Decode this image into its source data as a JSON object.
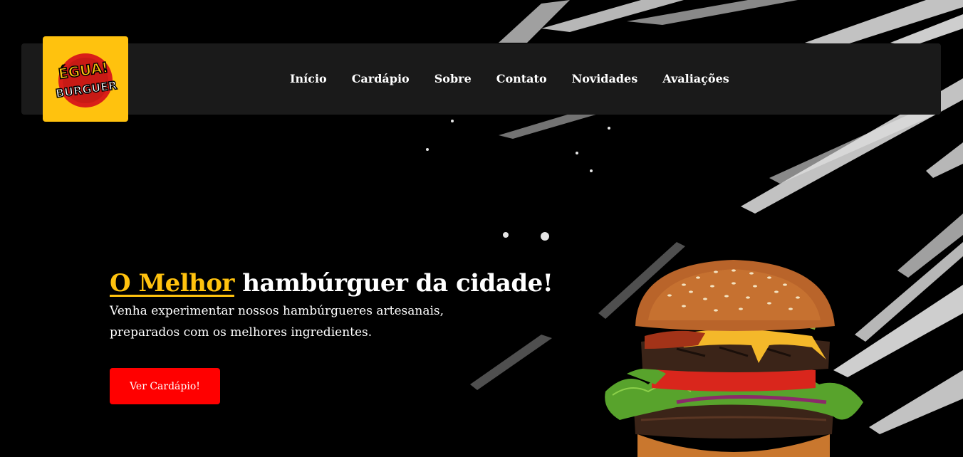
{
  "brand": {
    "logo_text_top": "ÉGUA!",
    "logo_text_bottom": "BURGUER",
    "logo_bg_color": "#ffc20e",
    "logo_splash_color": "#d91e18"
  },
  "nav": {
    "items": [
      {
        "label": "Início"
      },
      {
        "label": "Cardápio"
      },
      {
        "label": "Sobre"
      },
      {
        "label": "Contato"
      },
      {
        "label": "Novidades"
      },
      {
        "label": "Avaliações"
      }
    ]
  },
  "hero": {
    "title_accent": "O Melhor",
    "title_rest": " hambúrguer da cidade!",
    "subtitle_line1": "Venha experimentar nossos hambúrgueres artesanais,",
    "subtitle_line2": "preparados com os melhores ingredientes.",
    "cta_label": "Ver Cardápio!"
  },
  "colors": {
    "accent": "#ffc20e",
    "cta": "#ff0000",
    "navbar": "#1a1a1a",
    "background": "#000000"
  },
  "icons": {
    "hero_image": "burger-image"
  }
}
